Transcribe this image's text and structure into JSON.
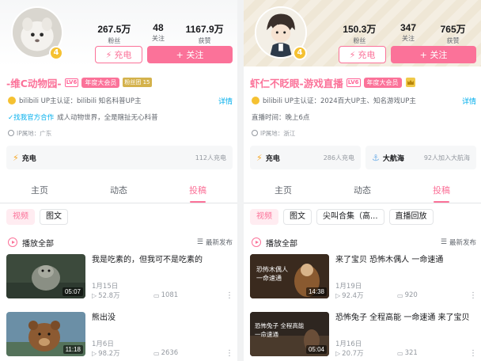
{
  "left": {
    "stats": [
      {
        "value": "267.5万",
        "label": "粉丝"
      },
      {
        "value": "48",
        "label": "关注"
      },
      {
        "value": "1167.9万",
        "label": "获赞"
      }
    ],
    "charge_label": "充电",
    "follow_label": "+ 关注",
    "level_badge": "4",
    "username": "-维C动物园-",
    "lv_tag": "LV6",
    "vip_tag": "年度大会员",
    "medal_tag": "粉丝团 15",
    "cert_text": "bilibili UP主认证：bilibili 知名科普UP主",
    "details": "详情",
    "coop_link": "找我官方合作",
    "bio": "成人动物世界，全是瞎扯无心科普",
    "ip_text": "IP属地：广东",
    "charge_card": {
      "title": "充电",
      "meta": "112人充电"
    },
    "tabs": [
      "主页",
      "动态",
      "投稿"
    ],
    "chips": [
      "视频",
      "图文"
    ],
    "play_all": "播放全部",
    "sort": "最新发布",
    "videos": [
      {
        "title": "我是吃素的，但我可不是吃素的",
        "duration": "05:07",
        "date": "1月15日",
        "views": "52.8万",
        "comments": "1081"
      },
      {
        "title": "熊出没",
        "duration": "11:18",
        "date": "1月6日",
        "views": "98.2万",
        "comments": "2636"
      }
    ]
  },
  "right": {
    "stats": [
      {
        "value": "150.3万",
        "label": "粉丝"
      },
      {
        "value": "347",
        "label": "关注"
      },
      {
        "value": "765万",
        "label": "获赞"
      }
    ],
    "charge_label": "充电",
    "follow_label": "+ 关注",
    "level_badge": "4",
    "username": "虾仁不眨眼-游戏直播",
    "lv_tag": "LV6",
    "vip_tag": "年度大会员",
    "cert_text": "bilibili UP主认证：2024百大UP主、知名游戏UP主",
    "details": "详情",
    "live_time": "直播时间：晚上6点",
    "ip_text": "IP属地：浙江",
    "charge_card": {
      "title": "充电",
      "meta": "286人充电"
    },
    "fleet_card": {
      "title": "大航海",
      "meta": "92人加入大航海"
    },
    "tabs": [
      "主页",
      "动态",
      "投稿"
    ],
    "chips": [
      "视频",
      "图文",
      "尖叫合集（高...",
      "直播回放"
    ],
    "play_all": "播放全部",
    "sort": "最新发布",
    "videos": [
      {
        "title": "来了宝贝 恐怖木偶人 一命速通",
        "duration": "14:38",
        "date": "1月19日",
        "views": "92.4万",
        "comments": "920",
        "thumb_text": [
          "恐怖木偶人",
          "一命速通"
        ]
      },
      {
        "title": "恐怖兔子 全程高能 一命速通 来了宝贝",
        "duration": "05:04",
        "date": "1月16日",
        "views": "20.7万",
        "comments": "321",
        "thumb_text": [
          "恐怖兔子 全程高能",
          "一命速通"
        ]
      }
    ]
  },
  "colors": {
    "brand_pink": "#fb7299",
    "link_blue": "#00aeec",
    "gold": "#f5c132"
  }
}
